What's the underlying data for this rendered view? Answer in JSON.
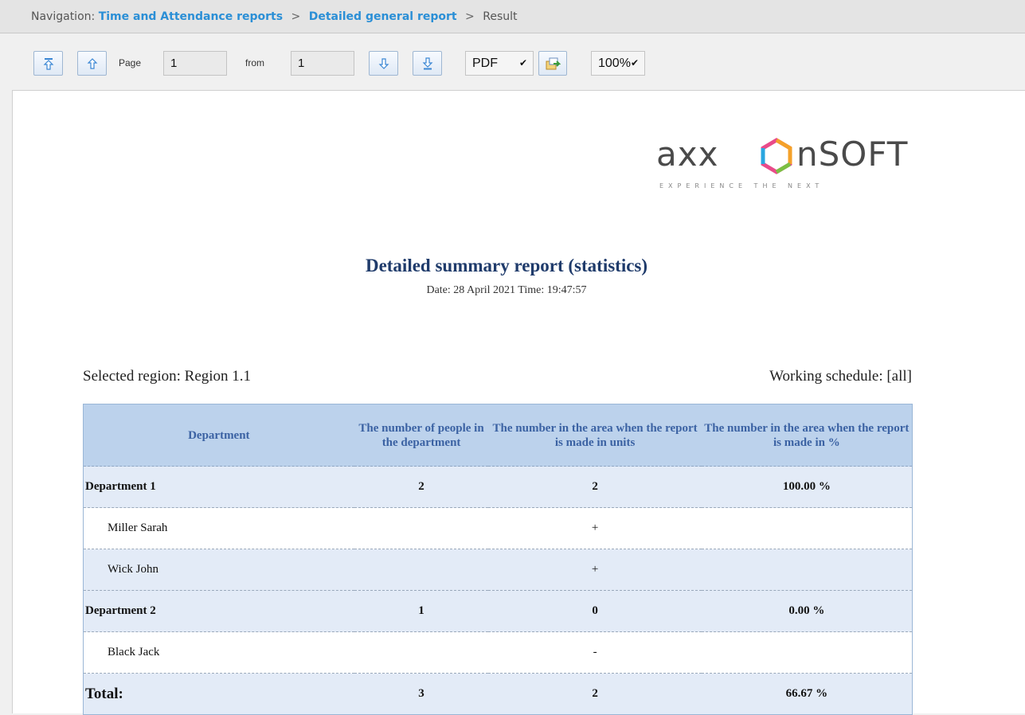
{
  "navigation": {
    "prefix": "Navigation:",
    "crumbs": [
      "Time and Attendance reports",
      "Detailed general report"
    ],
    "separator": ">",
    "current": "Result"
  },
  "toolbar": {
    "page_label": "Page",
    "page_value": "1",
    "from_label": "from",
    "from_value": "1",
    "format_value": "PDF",
    "zoom_value": "100%"
  },
  "logo": {
    "text_left": "axx",
    "text_right": "nSOFT",
    "tagline": "EXPERIENCE THE NEXT"
  },
  "report": {
    "title": "Detailed summary report (statistics)",
    "date_line": "Date: 28 April 2021 Time: 19:47:57",
    "region": "Selected region: Region 1.1",
    "schedule": "Working schedule: [all]",
    "columns": [
      "Department",
      "The number of people in the department",
      "The number in the area when the report is made in units",
      "The number in the area when the report is made in %"
    ],
    "rows": [
      {
        "type": "dept",
        "name": "Department 1",
        "people": "2",
        "units": "2",
        "percent": "100.00 %"
      },
      {
        "type": "emp",
        "name": "Miller Sarah",
        "people": "",
        "units": "+",
        "percent": ""
      },
      {
        "type": "emp",
        "name": "Wick John",
        "people": "",
        "units": "+",
        "percent": ""
      },
      {
        "type": "dept",
        "name": "Department 2",
        "people": "1",
        "units": "0",
        "percent": "0.00 %"
      },
      {
        "type": "emp",
        "name": "Black Jack",
        "people": "",
        "units": "-",
        "percent": ""
      }
    ],
    "total": {
      "name": "Total:",
      "people": "3",
      "units": "2",
      "percent": "66.67 %"
    }
  },
  "colors": {
    "link": "#2b8fd6",
    "header_bg": "#bcd2ec",
    "header_text": "#3b62a3",
    "row_bg": "#e3ebf7",
    "title": "#1f3b6b"
  },
  "icons": [
    "go-first-icon",
    "go-previous-icon",
    "go-next-icon",
    "go-last-icon",
    "export-icon",
    "chevron-down-icon",
    "axxon-logo-hexagon"
  ]
}
